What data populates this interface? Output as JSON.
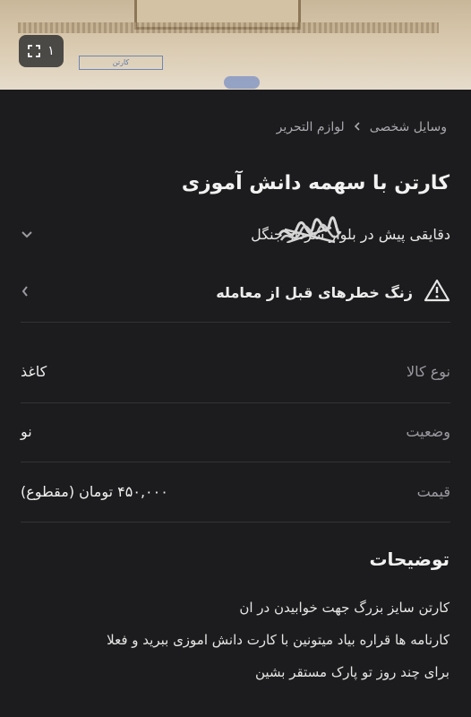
{
  "gallery": {
    "image_count": "۱",
    "expand_icon": "expand-icon",
    "box_print_text": "کارتن"
  },
  "breadcrumb": {
    "items": [
      "وسایل شخصی",
      "لوازم التحریر"
    ]
  },
  "listing": {
    "title": "کارتن با سهمه دانش آموزی",
    "location": "دقایقی پیش در بلوار سردار جنگل"
  },
  "warning": {
    "label": "زنگ خطرهای قبل از معامله"
  },
  "specs": [
    {
      "label": "نوع کالا",
      "value": "کاغذ"
    },
    {
      "label": "وضعیت",
      "value": "نو"
    },
    {
      "label": "قیمت",
      "value": "۴۵۰,۰۰۰ تومان (مقطوع)"
    }
  ],
  "description": {
    "heading": "توضیحات",
    "lines": [
      "کارتن سایز بزرگ جهت خوابیدن در ان",
      "کارنامه ها قراره بیاد میتونین با کارت دانش اموزی ببرید و فعلا",
      "برای چند روز تو پارک مستقر بشین"
    ]
  },
  "colors": {
    "background": "#1c1c1e",
    "text": "#ececec",
    "muted": "#9a9aa0"
  }
}
